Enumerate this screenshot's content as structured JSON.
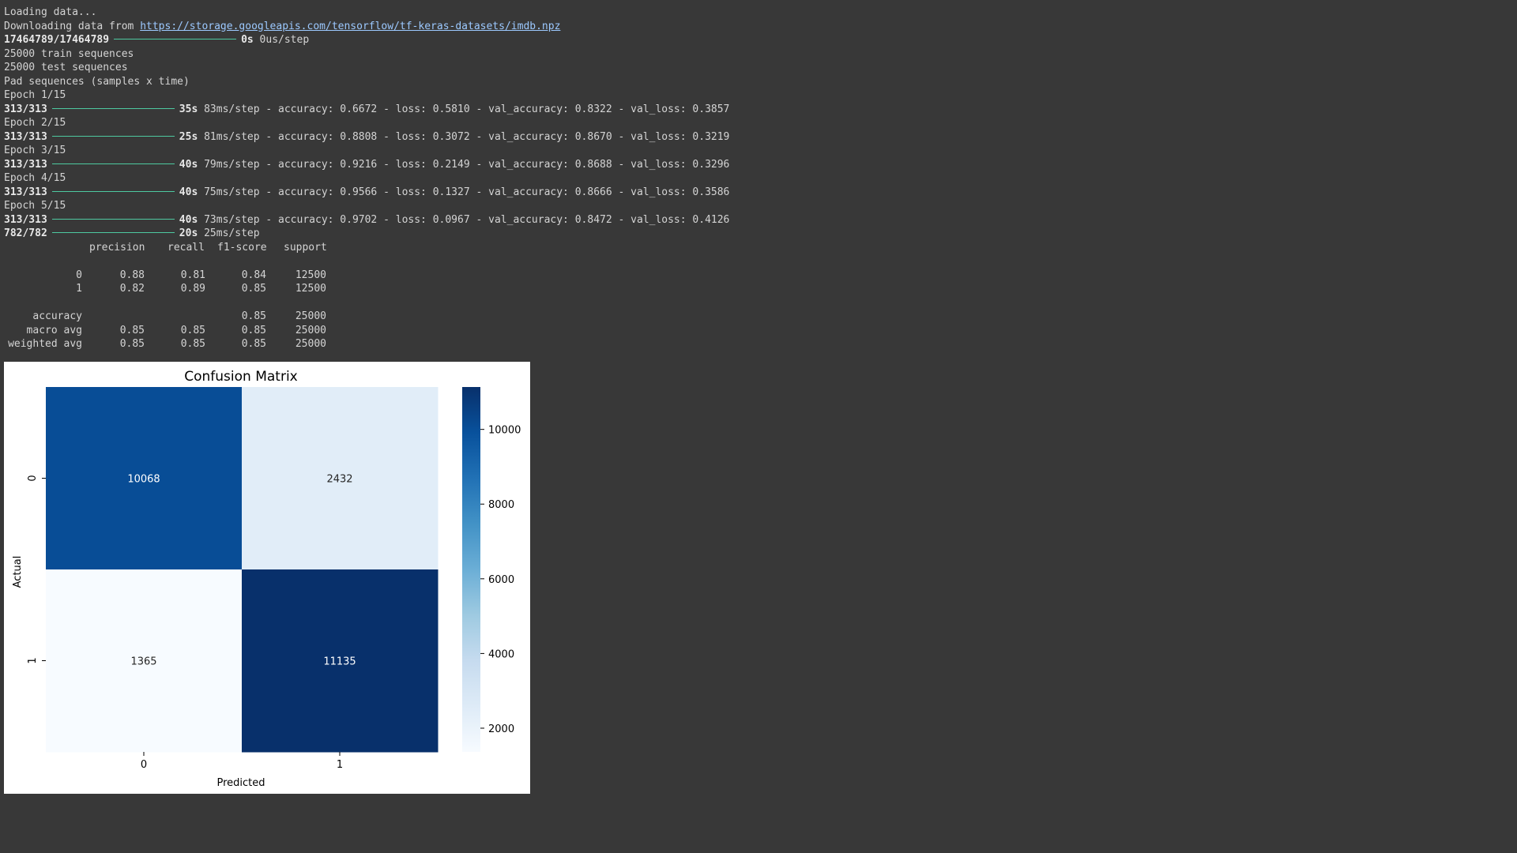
{
  "console": {
    "loading": "Loading data...",
    "download_prefix": "Downloading data from ",
    "download_url": "https://storage.googleapis.com/tensorflow/tf-keras-datasets/imdb.npz",
    "download_progress": "17464789/17464789",
    "download_time": "0s",
    "download_rate": "0us/step",
    "train_seq": "25000 train sequences",
    "test_seq": "25000 test sequences",
    "pad_seq": "Pad sequences (samples x time)",
    "epochs": [
      {
        "label": "Epoch 1/15",
        "steps": "313/313",
        "time": "35s",
        "metrics": "83ms/step - accuracy: 0.6672 - loss: 0.5810 - val_accuracy: 0.8322 - val_loss: 0.3857"
      },
      {
        "label": "Epoch 2/15",
        "steps": "313/313",
        "time": "25s",
        "metrics": "81ms/step - accuracy: 0.8808 - loss: 0.3072 - val_accuracy: 0.8670 - val_loss: 0.3219"
      },
      {
        "label": "Epoch 3/15",
        "steps": "313/313",
        "time": "40s",
        "metrics": "79ms/step - accuracy: 0.9216 - loss: 0.2149 - val_accuracy: 0.8688 - val_loss: 0.3296"
      },
      {
        "label": "Epoch 4/15",
        "steps": "313/313",
        "time": "40s",
        "metrics": "75ms/step - accuracy: 0.9566 - loss: 0.1327 - val_accuracy: 0.8666 - val_loss: 0.3586"
      },
      {
        "label": "Epoch 5/15",
        "steps": "313/313",
        "time": "40s",
        "metrics": "73ms/step - accuracy: 0.9702 - loss: 0.0967 - val_accuracy: 0.8472 - val_loss: 0.4126"
      }
    ],
    "predict_steps": "782/782",
    "predict_time": "20s",
    "predict_rate": "25ms/step"
  },
  "report": {
    "headers": [
      "precision",
      "recall",
      "f1-score",
      "support"
    ],
    "rows": [
      {
        "label": "0",
        "precision": "0.88",
        "recall": "0.81",
        "f1": "0.84",
        "support": "12500"
      },
      {
        "label": "1",
        "precision": "0.82",
        "recall": "0.89",
        "f1": "0.85",
        "support": "12500"
      },
      {
        "label": "accuracy",
        "precision": "",
        "recall": "",
        "f1": "0.85",
        "support": "25000"
      },
      {
        "label": "macro avg",
        "precision": "0.85",
        "recall": "0.85",
        "f1": "0.85",
        "support": "25000"
      },
      {
        "label": "weighted avg",
        "precision": "0.85",
        "recall": "0.85",
        "f1": "0.85",
        "support": "25000"
      }
    ]
  },
  "chart_data": {
    "type": "heatmap",
    "title": "Confusion Matrix",
    "xlabel": "Predicted",
    "ylabel": "Actual",
    "x_categories": [
      "0",
      "1"
    ],
    "y_categories": [
      "0",
      "1"
    ],
    "values": [
      [
        10068,
        2432
      ],
      [
        1365,
        11135
      ]
    ],
    "colorbar": {
      "min": 1365,
      "max": 11135,
      "ticks": [
        2000,
        4000,
        6000,
        8000,
        10000
      ],
      "colormap": "Blues"
    },
    "colors": {
      "low": "#f7fbff",
      "high": "#08306b"
    }
  }
}
